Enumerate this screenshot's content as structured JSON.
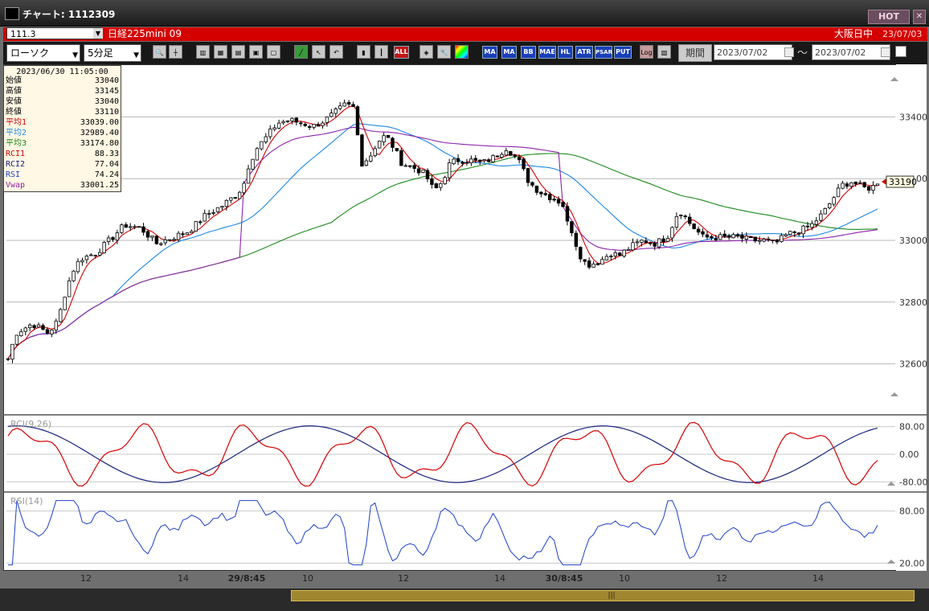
{
  "window": {
    "title": "チャート: 1112309",
    "hot_label": "HOT"
  },
  "symbol_bar": {
    "code": "111.3",
    "name": "日経225mini 09",
    "session": "大阪日中",
    "date": "23/07/03"
  },
  "toolbar": {
    "chart_type": "ローソク",
    "interval": "5分足",
    "tool_icons": [
      "zoom-icon",
      "crosshair-icon",
      "candle-style-icon",
      "grid-icon",
      "compare-icon",
      "calendar-icon",
      "trendline-icon",
      "cursor-icon",
      "undo-icon",
      "candle-icon",
      "bar-icon"
    ],
    "all_label": "ALL",
    "indicator_icons": [
      "palette-icon",
      "wrench-icon",
      "color-icon"
    ],
    "indicators": [
      "MA",
      "MA",
      "BB",
      "MAE",
      "HL",
      "ATR",
      "PSAR",
      "PUT"
    ],
    "log_label": "Log",
    "period_label": "期間",
    "date_from": "2023/07/02",
    "date_to": "2023/07/02",
    "tilde": "～"
  },
  "info_panel": {
    "timestamp": "2023/06/30  11:05:00",
    "rows": [
      {
        "label": "始値",
        "value": "33040",
        "color": "#000000"
      },
      {
        "label": "高値",
        "value": "33145",
        "color": "#000000"
      },
      {
        "label": "安値",
        "value": "33040",
        "color": "#000000"
      },
      {
        "label": "終値",
        "value": "33110",
        "color": "#000000"
      },
      {
        "label": "平均1",
        "value": "33039.00",
        "color": "#d40000"
      },
      {
        "label": "平均2",
        "value": "32989.40",
        "color": "#1e88e5"
      },
      {
        "label": "平均3",
        "value": "33174.80",
        "color": "#1b8a1b"
      },
      {
        "label": "RCI1",
        "value": "88.33",
        "color": "#d40000"
      },
      {
        "label": "RCI2",
        "value": "77.04",
        "color": "#1a237e"
      },
      {
        "label": "RSI",
        "value": "74.24",
        "color": "#1e40c8"
      },
      {
        "label": "Vwap",
        "value": "33001.25",
        "color": "#8e24aa"
      }
    ]
  },
  "price_chart": {
    "y_ticks": [
      "33400",
      "33000",
      "32800",
      "32600"
    ],
    "y_tick_values": [
      33400,
      33000,
      32800,
      32600
    ],
    "partial_tick_value": 33200,
    "partial_tick_label": "00",
    "current_price": "33190",
    "current_price_value": 33190,
    "y_range": [
      32440,
      33560
    ]
  },
  "rci_panel": {
    "label": "RCI(9,26)",
    "y_ticks": [
      "80.00",
      "0.00",
      "-80.00"
    ],
    "y_tick_values": [
      80,
      0,
      -80
    ]
  },
  "rsi_panel": {
    "label": "RSI(14)",
    "y_ticks": [
      "80.00",
      "20.00"
    ],
    "y_tick_values": [
      80,
      20
    ]
  },
  "x_axis": {
    "labels": [
      "12",
      "14",
      "29/8:45",
      "10",
      "12",
      "14",
      "30/8:45",
      "10",
      "12",
      "14"
    ],
    "bold": [
      false,
      false,
      true,
      false,
      false,
      false,
      true,
      false,
      false,
      false
    ]
  },
  "chart_data": {
    "type": "candlestick",
    "interval": "5分足",
    "y_unit": "price",
    "key_points": [
      {
        "session": "day1",
        "time": "12",
        "approx_price": 32900
      },
      {
        "session": "day1",
        "time": "14",
        "approx_price": 33000
      },
      {
        "session": "29",
        "time": "10",
        "approx_price": 33450
      },
      {
        "session": "29",
        "time": "12",
        "approx_price": 33250
      },
      {
        "session": "29",
        "time": "14",
        "approx_price": 33300
      },
      {
        "session": "30",
        "time": "10",
        "approx_price": 32950
      },
      {
        "session": "30",
        "time": "12",
        "approx_price": 33010
      },
      {
        "session": "30",
        "time": "14",
        "approx_price": 33150
      },
      {
        "session": "30",
        "time": "last",
        "approx_price": 33190
      }
    ],
    "series": [
      {
        "name": "平均1",
        "color": "#d40000"
      },
      {
        "name": "平均2",
        "color": "#1e88e5"
      },
      {
        "name": "平均3",
        "color": "#1b8a1b"
      },
      {
        "name": "Vwap",
        "color": "#8e24aa"
      },
      {
        "name": "RCI1",
        "color": "#d40000"
      },
      {
        "name": "RCI2",
        "color": "#1a237e"
      },
      {
        "name": "RSI",
        "color": "#1e40c8"
      }
    ],
    "grid": true
  }
}
